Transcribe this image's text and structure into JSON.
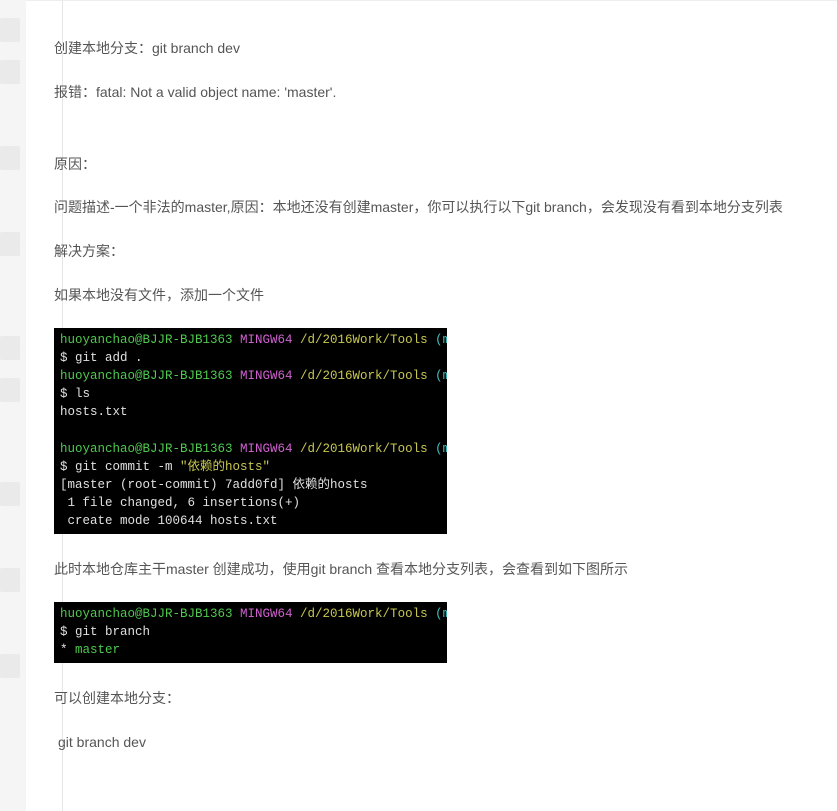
{
  "para1": "创建本地分支：git branch dev",
  "para2": "报错：fatal: Not a valid object name: 'master'.",
  "para3": "原因：",
  "para4": " 问题描述-一个非法的master,原因：本地还没有创建master，你可以执行以下git branch，会发现没有看到本地分支列表",
  "para5": "解决方案：",
  "para6": "  如果本地没有文件，添加一个文件",
  "para7": "此时本地仓库主干master 创建成功，使用git branch 查看本地分支列表，会查看到如下图所示",
  "para8": "可以创建本地分支：",
  "para9": " git branch dev",
  "prompt": {
    "userhost": "huoyanchao@BJJR-BJB1363 ",
    "shell": "MINGW64 ",
    "path": "/d/2016Work/Tools ",
    "branch": "(master)"
  },
  "term1": {
    "l1": "$ git add .",
    "l2": "$ ls",
    "l3": "hosts.txt",
    "l4a": "$ git commit -m ",
    "l4b": "\"依赖的hosts\"",
    "l5": "[master (root-commit) 7add0fd] 依赖的hosts",
    "l6": " 1 file changed, 6 insertions(+)",
    "l7": " create mode 100644 hosts.txt"
  },
  "term2": {
    "l1": "$ git branch",
    "l2a": "* ",
    "l2b": "master"
  }
}
